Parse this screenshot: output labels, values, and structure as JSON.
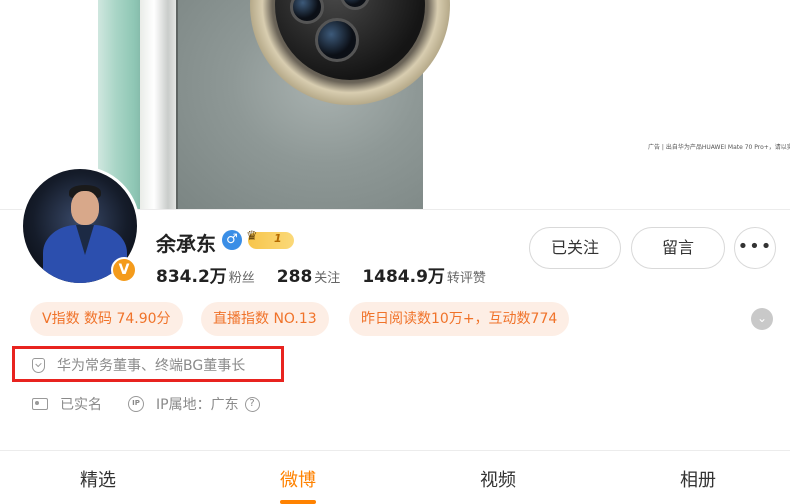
{
  "banner": {
    "ad_note": "广告 | 出自华为产品HUAWEI Mate 70 Pro+，请以实物为准，请以实物为准"
  },
  "profile": {
    "name": "余承东",
    "level": "1",
    "stats": [
      {
        "value": "834.2万",
        "label": "粉丝"
      },
      {
        "value": "288",
        "label": "关注"
      },
      {
        "value": "1484.9万",
        "label": "转评赞"
      }
    ]
  },
  "actions": {
    "followed_label": "已关注",
    "message_label": "留言",
    "more_label": "•••"
  },
  "tags": [
    "V指数 数码 74.90分",
    "直播指数 NO.13",
    "昨日阅读数10万+，互动数774"
  ],
  "info": {
    "title": "华为常务董事、终端BG董事长",
    "verified": "已实名",
    "ip_location": "IP属地：广东",
    "ip_icon_text": "IP",
    "help_icon_text": "?"
  },
  "tabs": [
    {
      "label": "精选"
    },
    {
      "label": "微博",
      "active": true
    },
    {
      "label": "视频"
    },
    {
      "label": "相册"
    }
  ],
  "colors": {
    "accent": "#ff8200",
    "tag_bg": "#fdeee5",
    "tag_text": "#f0732a",
    "highlight": "#e8231f",
    "verified_badge": "#f49b1b",
    "gender": "#3a8ee6"
  },
  "icons": {
    "verified": "v-badge-icon",
    "gender": "male-icon",
    "level": "crown-level-icon",
    "title": "shield-icon",
    "real_name": "id-card-icon",
    "ip": "ip-icon",
    "help": "question-icon",
    "expand": "chevron-down-icon"
  }
}
